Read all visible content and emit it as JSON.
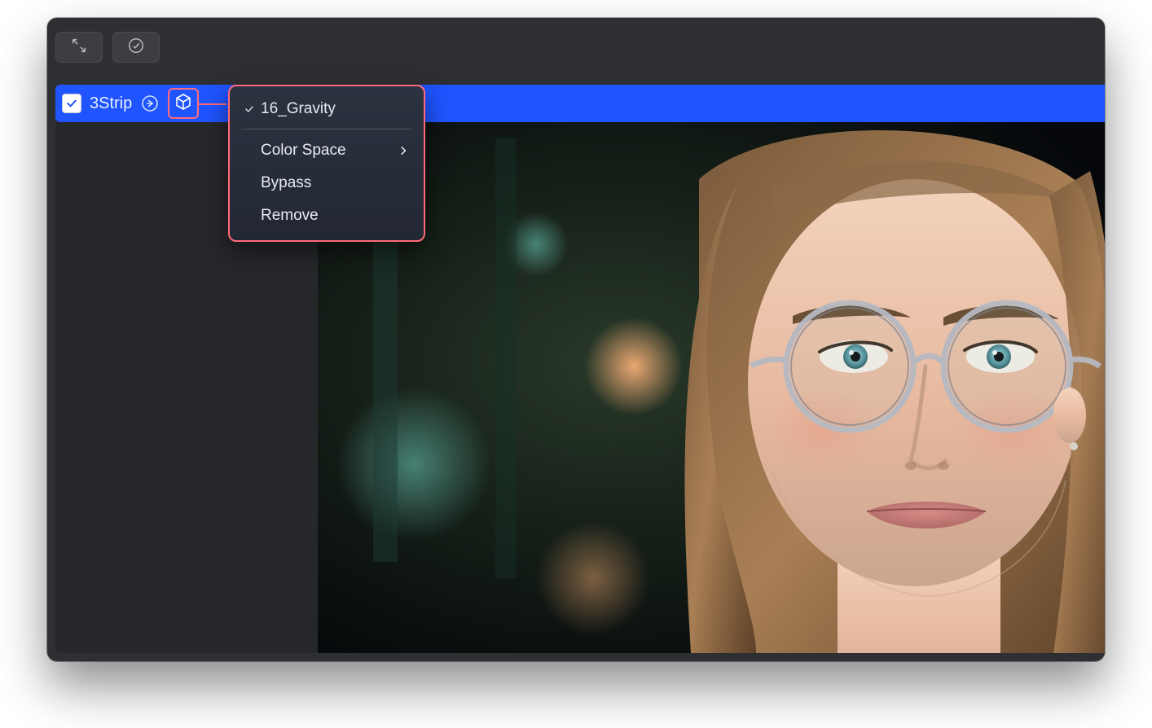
{
  "toolbar": {
    "expand_icon": "expand-diagonal",
    "confirm_icon": "circle-check"
  },
  "filter_strip": {
    "enabled": true,
    "label": "3Strip",
    "arrow_icon": "arrow-right-circle",
    "cube_icon": "cube"
  },
  "context_menu": {
    "active_lut": "16_Gravity",
    "items": [
      {
        "label": "Color Space",
        "submenu": true
      },
      {
        "label": "Bypass"
      },
      {
        "label": "Remove"
      }
    ]
  },
  "viewer": {
    "content": "portrait-photo-placeholder"
  },
  "highlight_color": "#ff6a7a",
  "accent_color": "#1f54ff"
}
